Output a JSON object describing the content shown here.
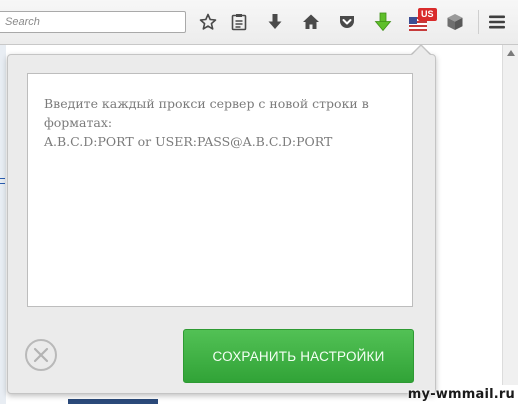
{
  "toolbar": {
    "search_placeholder": "Search",
    "icons": [
      {
        "name": "bookmark-star-icon"
      },
      {
        "name": "reading-list-icon"
      },
      {
        "name": "downloads-icon"
      },
      {
        "name": "home-icon"
      },
      {
        "name": "pocket-icon"
      },
      {
        "name": "green-download-icon"
      },
      {
        "name": "vpn-flag-icon"
      },
      {
        "name": "package-icon"
      },
      {
        "name": "menu-icon"
      }
    ],
    "vpn_badge": "US",
    "accent_green": "#4cb84f",
    "badge_red": "#d92b2b"
  },
  "popup": {
    "textarea_placeholder": "Введите каждый прокси сервер с новой строки в форматах:\nA.B.C.D:PORT or USER:PASS@A.B.C.D:PORT",
    "save_label": "СОХРАНИТЬ НАСТРОЙКИ",
    "close_icon": "close-circle-icon"
  },
  "watermark": "my-wmmail.ru"
}
